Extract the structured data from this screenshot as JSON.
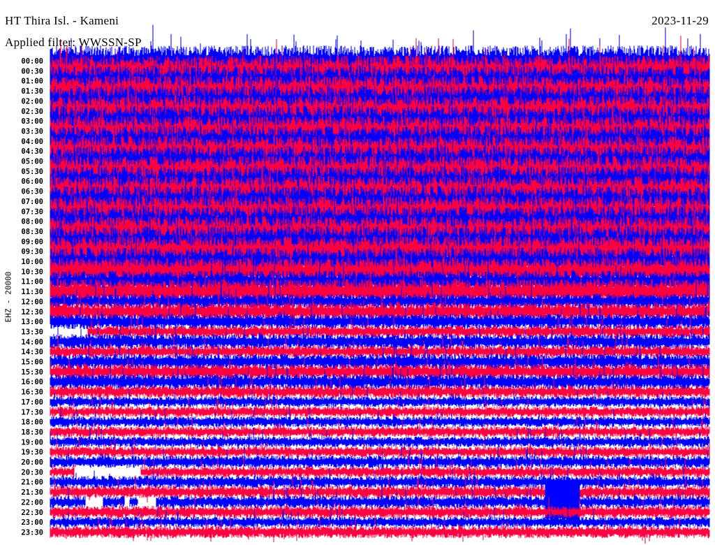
{
  "header": {
    "station": "HT Thira Isl. - Kameni",
    "date": "2023-11-29",
    "filter": "Applied filter: WWSSN-SP"
  },
  "channel_label": "EHZ - 20000",
  "chart_data": {
    "type": "helicorder",
    "title": "HT Thira Isl. - Kameni",
    "minutes_per_line": 30,
    "colors": {
      "even": "#0000ff",
      "odd": "#ff0040"
    },
    "rows": [
      {
        "label": "00:00",
        "level": 1.0
      },
      {
        "label": "00:30",
        "level": 1.0
      },
      {
        "label": "01:00",
        "level": 1.0
      },
      {
        "label": "01:30",
        "level": 1.0
      },
      {
        "label": "02:00",
        "level": 1.0
      },
      {
        "label": "02:30",
        "level": 1.0
      },
      {
        "label": "03:00",
        "level": 1.0
      },
      {
        "label": "03:30",
        "level": 1.0
      },
      {
        "label": "04:00",
        "level": 1.0
      },
      {
        "label": "04:30",
        "level": 1.0
      },
      {
        "label": "05:00",
        "level": 1.0
      },
      {
        "label": "05:30",
        "level": 1.0
      },
      {
        "label": "06:00",
        "level": 1.0
      },
      {
        "label": "06:30",
        "level": 1.0
      },
      {
        "label": "07:00",
        "level": 1.0
      },
      {
        "label": "07:30",
        "level": 1.0
      },
      {
        "label": "08:00",
        "level": 1.0
      },
      {
        "label": "08:30",
        "level": 1.0
      },
      {
        "label": "09:00",
        "level": 1.0
      },
      {
        "label": "09:30",
        "level": 1.0
      },
      {
        "label": "10:00",
        "level": 0.9
      },
      {
        "label": "10:30",
        "level": 0.9
      },
      {
        "label": "11:00",
        "level": 0.7
      },
      {
        "label": "11:30",
        "level": 0.8
      },
      {
        "label": "12:00",
        "level": 0.5
      },
      {
        "label": "12:30",
        "level": 0.6
      },
      {
        "label": "13:00",
        "level": 0.5
      },
      {
        "label": "13:30",
        "level": 0.4,
        "gaps": [
          [
            0,
            1.7
          ]
        ]
      },
      {
        "label": "14:00",
        "level": 0.5
      },
      {
        "label": "14:30",
        "level": 0.4
      },
      {
        "label": "15:00",
        "level": 0.5
      },
      {
        "label": "15:30",
        "level": 0.5
      },
      {
        "label": "16:00",
        "level": 0.5
      },
      {
        "label": "16:30",
        "level": 0.4
      },
      {
        "label": "17:00",
        "level": 0.35
      },
      {
        "label": "17:30",
        "level": 0.35
      },
      {
        "label": "18:00",
        "level": 0.35
      },
      {
        "label": "18:30",
        "level": 0.35
      },
      {
        "label": "19:00",
        "level": 0.35
      },
      {
        "label": "19:30",
        "level": 0.35
      },
      {
        "label": "20:00",
        "level": 0.4
      },
      {
        "label": "20:30",
        "level": 0.35,
        "gaps": [
          [
            1.1,
            4.1
          ]
        ]
      },
      {
        "label": "21:00",
        "level": 0.4
      },
      {
        "label": "21:30",
        "level": 0.4
      },
      {
        "label": "22:00",
        "level": 0.4,
        "gaps": [
          [
            1.6,
            2.4
          ],
          [
            3.4,
            3.6
          ],
          [
            4.0,
            4.8
          ]
        ],
        "event_minute": 23.3
      },
      {
        "label": "22:30",
        "level": 0.4
      },
      {
        "label": "23:00",
        "level": 0.35
      },
      {
        "label": "23:30",
        "level": 0.4
      }
    ]
  }
}
